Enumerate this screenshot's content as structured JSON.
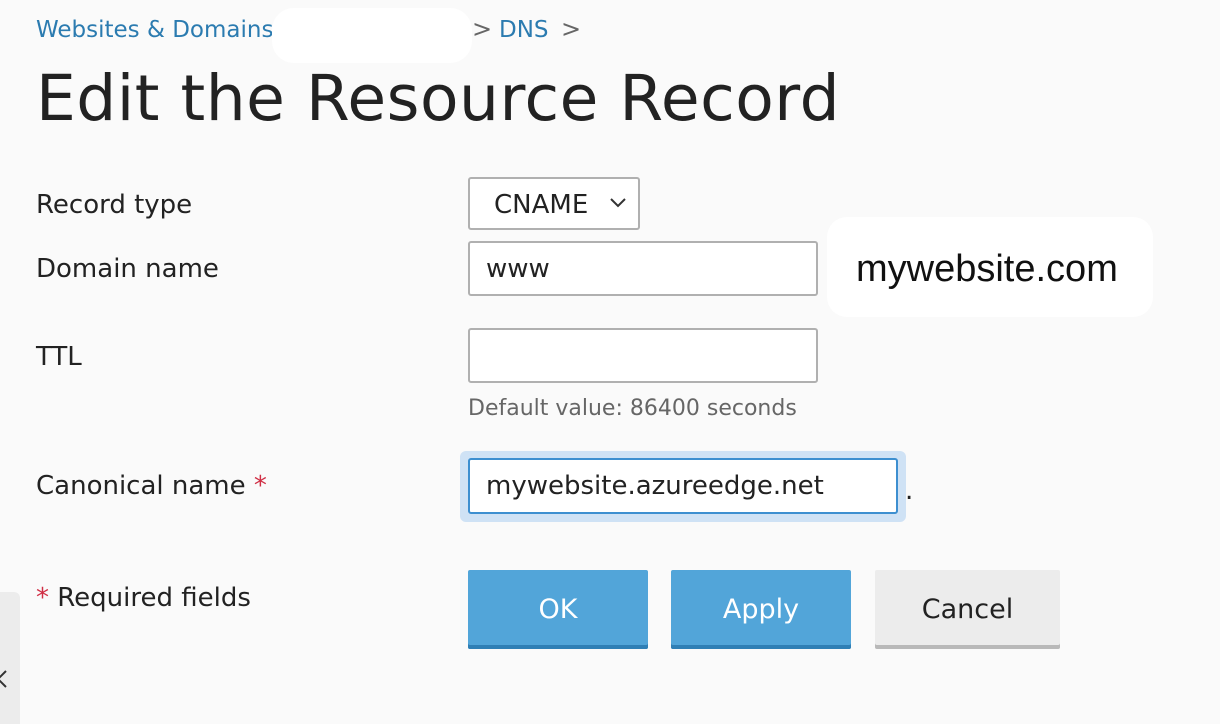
{
  "breadcrumb": {
    "items": [
      "Websites & Domains",
      "DNS"
    ],
    "separator": ">"
  },
  "page": {
    "title": "Edit the Resource Record"
  },
  "form": {
    "record_type_label": "Record type",
    "record_type_value": "CNAME",
    "domain_name_label": "Domain name",
    "domain_name_value": "www",
    "domain_suffix": "mywebsite.com",
    "ttl_label": "TTL",
    "ttl_value": "",
    "ttl_hint": "Default value: 86400 seconds",
    "canonical_name_label": "Canonical name",
    "canonical_name_value": "mywebsite.azureedge.net",
    "canonical_suffix": ".",
    "required_marker": "*",
    "required_note": "Required fields"
  },
  "buttons": {
    "ok": "OK",
    "apply": "Apply",
    "cancel": "Cancel"
  },
  "colors": {
    "link": "#2b7bb0",
    "primary_button": "#52a5d9",
    "required_asterisk": "#d02f45",
    "focus_border": "#3d8fd0"
  },
  "icons": {
    "select_arrow": "chevron-down-icon",
    "side_toggle": "chevron-left-icon"
  }
}
